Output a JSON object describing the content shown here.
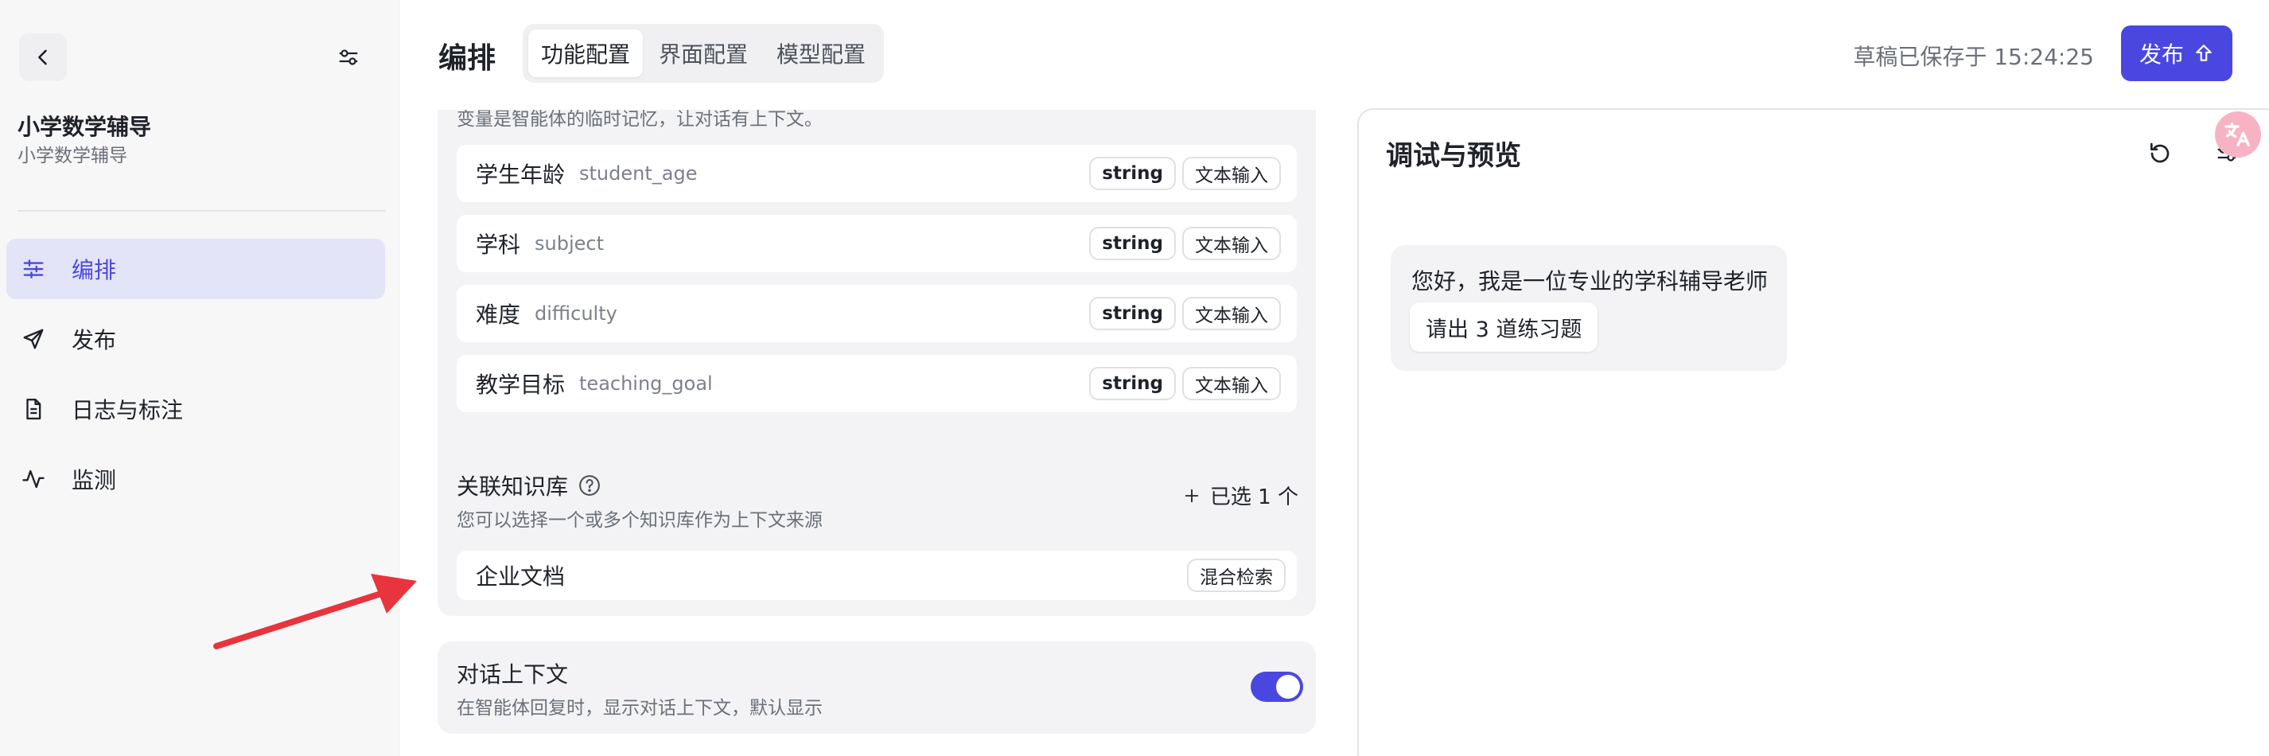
{
  "sidebar": {
    "app_name": "小学数学辅导",
    "app_subtitle": "小学数学辅导",
    "items": [
      {
        "label": "编排",
        "icon": "sliders-icon",
        "active": true
      },
      {
        "label": "发布",
        "icon": "send-icon",
        "active": false
      },
      {
        "label": "日志与标注",
        "icon": "document-icon",
        "active": false
      },
      {
        "label": "监测",
        "icon": "activity-icon",
        "active": false
      }
    ]
  },
  "header": {
    "title": "编排",
    "tabs": [
      {
        "label": "功能配置",
        "active": true
      },
      {
        "label": "界面配置",
        "active": false
      },
      {
        "label": "模型配置",
        "active": false
      }
    ],
    "save_status": "草稿已保存于 15:24:25",
    "publish_label": "发布"
  },
  "variables": {
    "description": "变量是智能体的临时记忆，让对话有上下文。",
    "items": [
      {
        "name": "学生年龄",
        "key": "student_age",
        "type": "string",
        "input": "文本输入"
      },
      {
        "name": "学科",
        "key": "subject",
        "type": "string",
        "input": "文本输入"
      },
      {
        "name": "难度",
        "key": "difficulty",
        "type": "string",
        "input": "文本输入"
      },
      {
        "name": "教学目标",
        "key": "teaching_goal",
        "type": "string",
        "input": "文本输入"
      }
    ]
  },
  "knowledge": {
    "title": "关联知识库",
    "subtitle": "您可以选择一个或多个知识库作为上下文来源",
    "add_label": "已选 1 个",
    "items": [
      {
        "name": "企业文档",
        "mode": "混合检索"
      }
    ]
  },
  "context": {
    "title": "对话上下文",
    "subtitle": "在智能体回复时，显示对话上下文，默认显示",
    "enabled": true
  },
  "preview": {
    "title": "调试与预览",
    "greeting": "您好，我是一位专业的学科辅导老师",
    "suggestion": "请出 3 道练习题"
  },
  "colors": {
    "accent": "#4a47e0",
    "arrow": "#e8343c",
    "translate_badge": "#f7b3c4"
  }
}
